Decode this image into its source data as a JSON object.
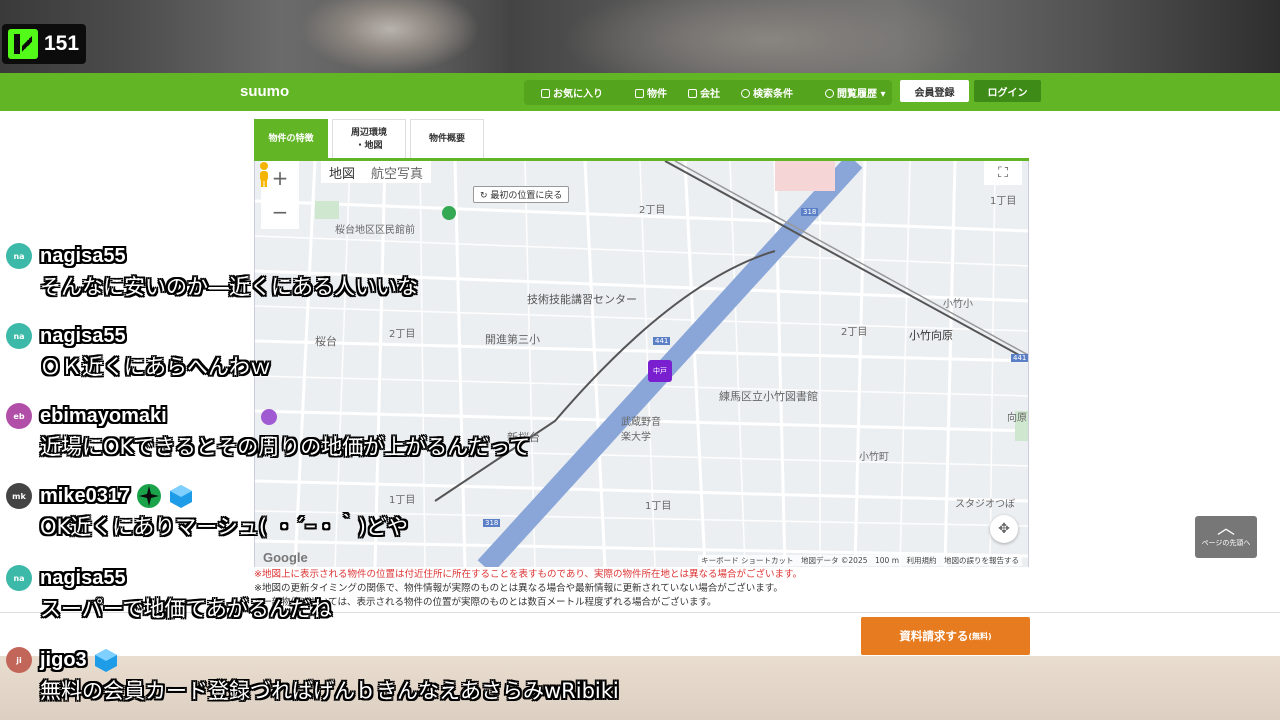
{
  "stream": {
    "viewer_count": "151",
    "kick_logo": "kick-logo",
    "accent": "#53fc18"
  },
  "site": {
    "brand": "suumo",
    "nav": [
      {
        "label": "お気に入り",
        "icon": "checkbox-icon"
      },
      {
        "label": "物件",
        "icon": "home-icon"
      },
      {
        "label": "会社",
        "icon": "building-icon"
      },
      {
        "label": "検索条件",
        "icon": "search-icon"
      },
      {
        "label": "閲覧履歴",
        "icon": "history-icon"
      }
    ],
    "register_label": "会員登録",
    "login_label": "ログイン",
    "accent": "#62b524"
  },
  "tabs": [
    {
      "label": "物件の特徴",
      "active": true
    },
    {
      "label": "周辺環境\n・地図",
      "active": false
    },
    {
      "label": "物件概要",
      "active": false
    }
  ],
  "map": {
    "type_map": "地図",
    "type_satellite": "航空写真",
    "zoom_in": "+",
    "zoom_out": "−",
    "return_label": "最初の位置に戻る",
    "marker_label": "中戸",
    "google": "Google",
    "attribution": "キーボード ショートカット　地図データ ©2025　100 m　利用規約　地図の誤りを報告する",
    "labels": [
      "桜台地区区民館前",
      "2丁目",
      "技術技能講習センター",
      "開進第三小",
      "桜台",
      "2丁目",
      "武蔵野音楽大学",
      "新桜台",
      "練馬区立小竹図書館",
      "小竹町",
      "小竹向原",
      "2丁目",
      "1丁目",
      "小竹小",
      "1丁目",
      "1丁目",
      "スタジオつぼ",
      "向原",
      "318",
      "441",
      "441",
      "318"
    ]
  },
  "notes": [
    "※地図上に表示される物件の位置は付近住所に所在することを表すものであり、実際の物件所在地とは異なる場合がございます。",
    "※地図の更新タイミングの関係で、物件情報が実際のものとは異なる場合や最新情報に更新されていない場合がございます。",
    "※一部物件においては、表示される物件の位置が実際のものとは数百メートル程度ずれる場合がございます。"
  ],
  "doc_request": {
    "label": "資料請求する",
    "sub": "(無料)"
  },
  "page_top": "ページの先頭へ",
  "chat": [
    {
      "user": "nagisa55",
      "initials": "na",
      "color": "#3cb9a8",
      "text": "そんなに安いのか―近くにある人いいな"
    },
    {
      "user": "nagisa55",
      "initials": "na",
      "color": "#3cb9a8",
      "text": "ＯＫ近くにあらへんわｗ"
    },
    {
      "user": "ebimayomaki",
      "initials": "eb",
      "color": "#b14fa8",
      "text": "近場にOKできるとその周りの地価が上がるんだって"
    },
    {
      "user": "mike0317",
      "initials": "mk",
      "color": "#444444",
      "text": "OK近くにありマーシュ( ・´ｰ・｀)どや"
    },
    {
      "user": "nagisa55",
      "initials": "na",
      "color": "#3cb9a8",
      "text": "スーパーで地価てあがるんだね"
    },
    {
      "user": "jigo3",
      "initials": "ji",
      "color": "#c2665a",
      "text": "無料の会員カード登録づればげんｂきんなえあさらみwRibiki"
    }
  ]
}
